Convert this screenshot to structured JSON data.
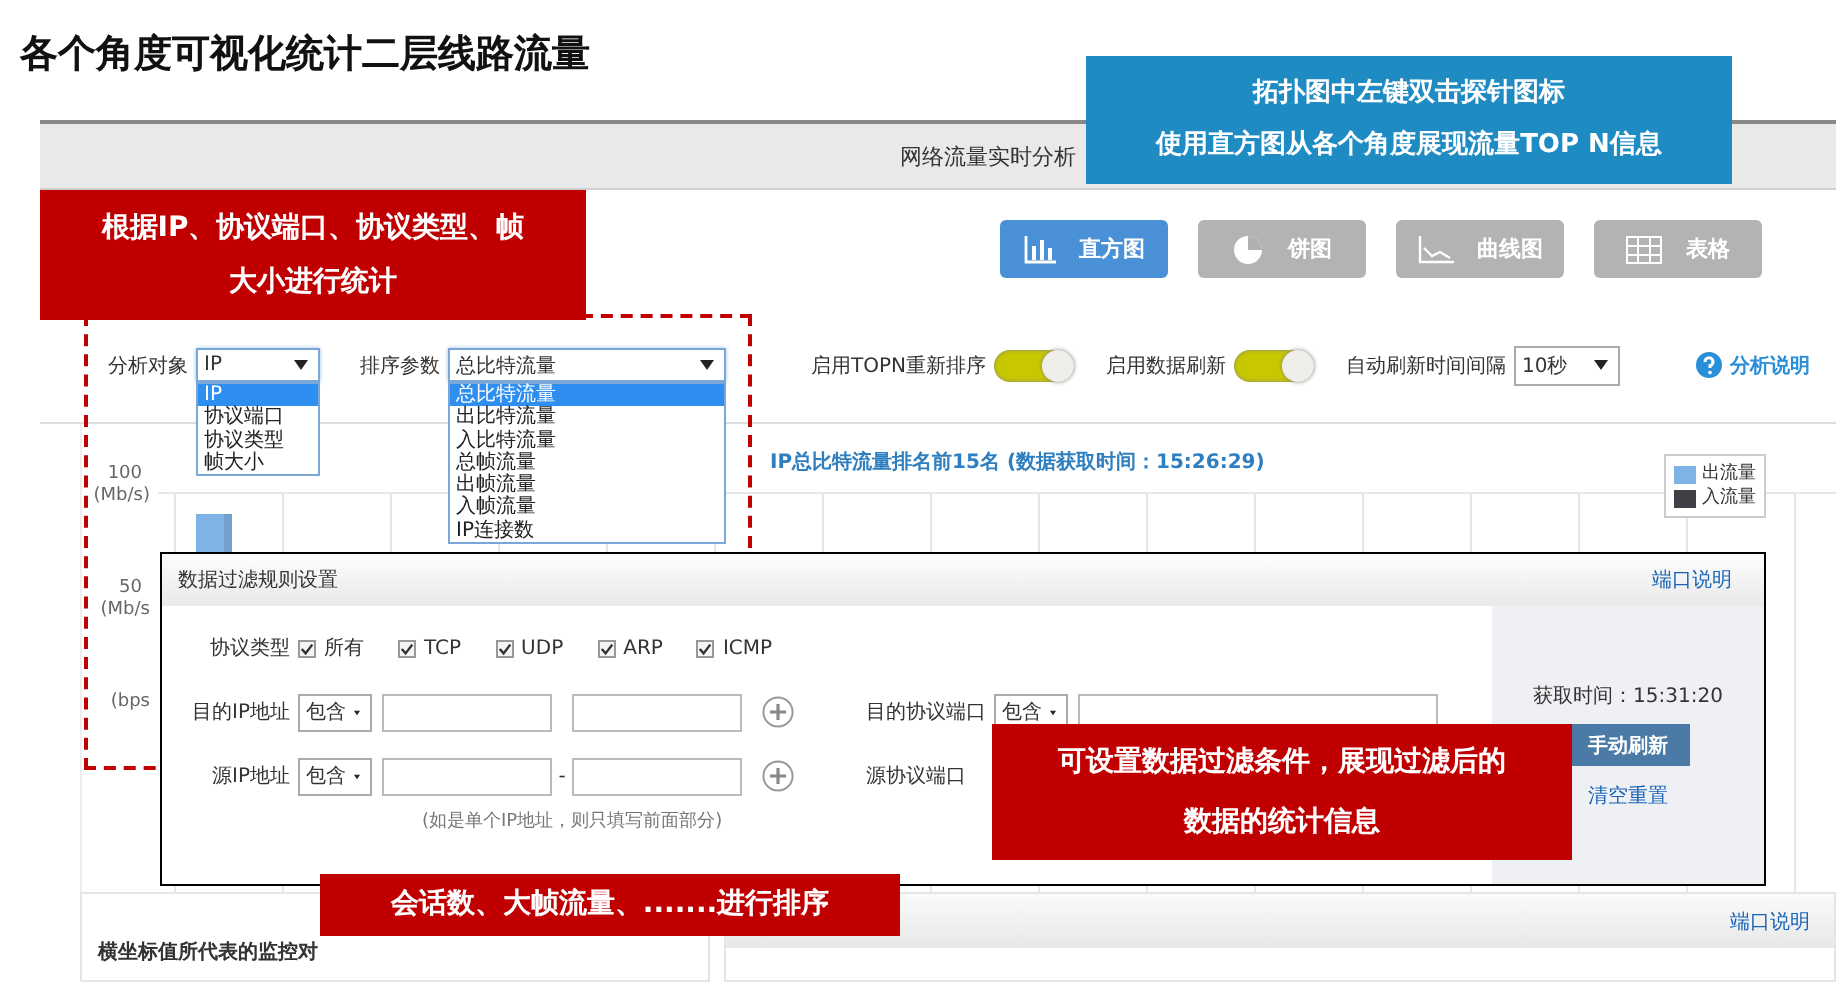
{
  "title": "各个角度可视化统计二层线路流量",
  "header": {
    "title": "网络流量实时分析"
  },
  "chart_types": [
    {
      "label": "直方图",
      "kind": "bar",
      "selected": true
    },
    {
      "label": "饼图",
      "kind": "pie",
      "selected": false
    },
    {
      "label": "曲线图",
      "kind": "line",
      "selected": false
    },
    {
      "label": "表格",
      "kind": "table",
      "selected": false
    }
  ],
  "analysis_object": {
    "label": "分析对象",
    "value": "IP",
    "options": [
      {
        "label": "IP",
        "selected": true
      },
      {
        "label": "协议端口",
        "selected": false
      },
      {
        "label": "协议类型",
        "selected": false
      },
      {
        "label": "帧大小",
        "selected": false
      }
    ]
  },
  "sort_param": {
    "label": "排序参数",
    "value": "总比特流量",
    "options": [
      {
        "label": "总比特流量",
        "selected": true
      },
      {
        "label": "出比特流量",
        "selected": false
      },
      {
        "label": "入比特流量",
        "selected": false
      },
      {
        "label": "总帧流量",
        "selected": false
      },
      {
        "label": "出帧流量",
        "selected": false
      },
      {
        "label": "入帧流量",
        "selected": false
      },
      {
        "label": "IP连接数",
        "selected": false
      }
    ]
  },
  "toggles": [
    {
      "label": "启用TOPN重新排序",
      "on": true
    },
    {
      "label": "启用数据刷新",
      "on": true
    }
  ],
  "refresh_interval": {
    "label": "自动刷新时间间隔",
    "value": "10秒"
  },
  "help_link": "分析说明",
  "chart": {
    "title": "IP总比特流量排名前15名 (数据获取时间：15:26:29)",
    "y_labels": [
      {
        "value": "100",
        "unit": "(Mb/s)"
      },
      {
        "value": "50",
        "unit": "(Mb/s"
      },
      {
        "unit": "(bps"
      }
    ],
    "legend": [
      {
        "label": "出流量",
        "color": "#7fb2e5"
      },
      {
        "label": "入流量",
        "color": "#3f3f46"
      }
    ]
  },
  "dialog": {
    "title": "数据过滤规则设置",
    "help_link": "端口说明",
    "protocol": {
      "label": "协议类型",
      "options": [
        {
          "label": "所有",
          "checked": true
        },
        {
          "label": "TCP",
          "checked": true
        },
        {
          "label": "UDP",
          "checked": true
        },
        {
          "label": "ARP",
          "checked": true
        },
        {
          "label": "ICMP",
          "checked": true
        }
      ]
    },
    "dest_ip": {
      "label": "目的IP地址",
      "mode": "包含"
    },
    "dest_port": {
      "label": "目的协议端口",
      "mode": "包含"
    },
    "src_ip": {
      "label": "源IP地址",
      "mode": "包含",
      "separator": "-"
    },
    "src_port": {
      "label": "源协议端口"
    },
    "hint": "(如是单个IP地址，则只填写前面部分)",
    "fetch_time": "获取时间：15:31:20",
    "refresh_button": "手动刷新",
    "reset_link": "清空重置"
  },
  "bottom": {
    "list_title": "横坐标值所代表的监控对",
    "port_link": "端口说明"
  },
  "callouts": [
    {
      "lines": [
        "拓扑图中左键双击探针图标",
        "使用直方图从各个角度展现流量TOP N信息"
      ],
      "color": "#1e8bc3"
    },
    {
      "lines": [
        "根据IP、协议端口、协议类型、帧",
        "大小进行统计"
      ],
      "color": "#c00000"
    },
    {
      "lines": [
        "可设置数据过滤条件，展现过滤后的",
        "数据的统计信息"
      ],
      "color": "#c00000"
    },
    {
      "lines": [
        "会话数、大帧流量、.......进行排序"
      ],
      "color": "#c00000"
    }
  ]
}
